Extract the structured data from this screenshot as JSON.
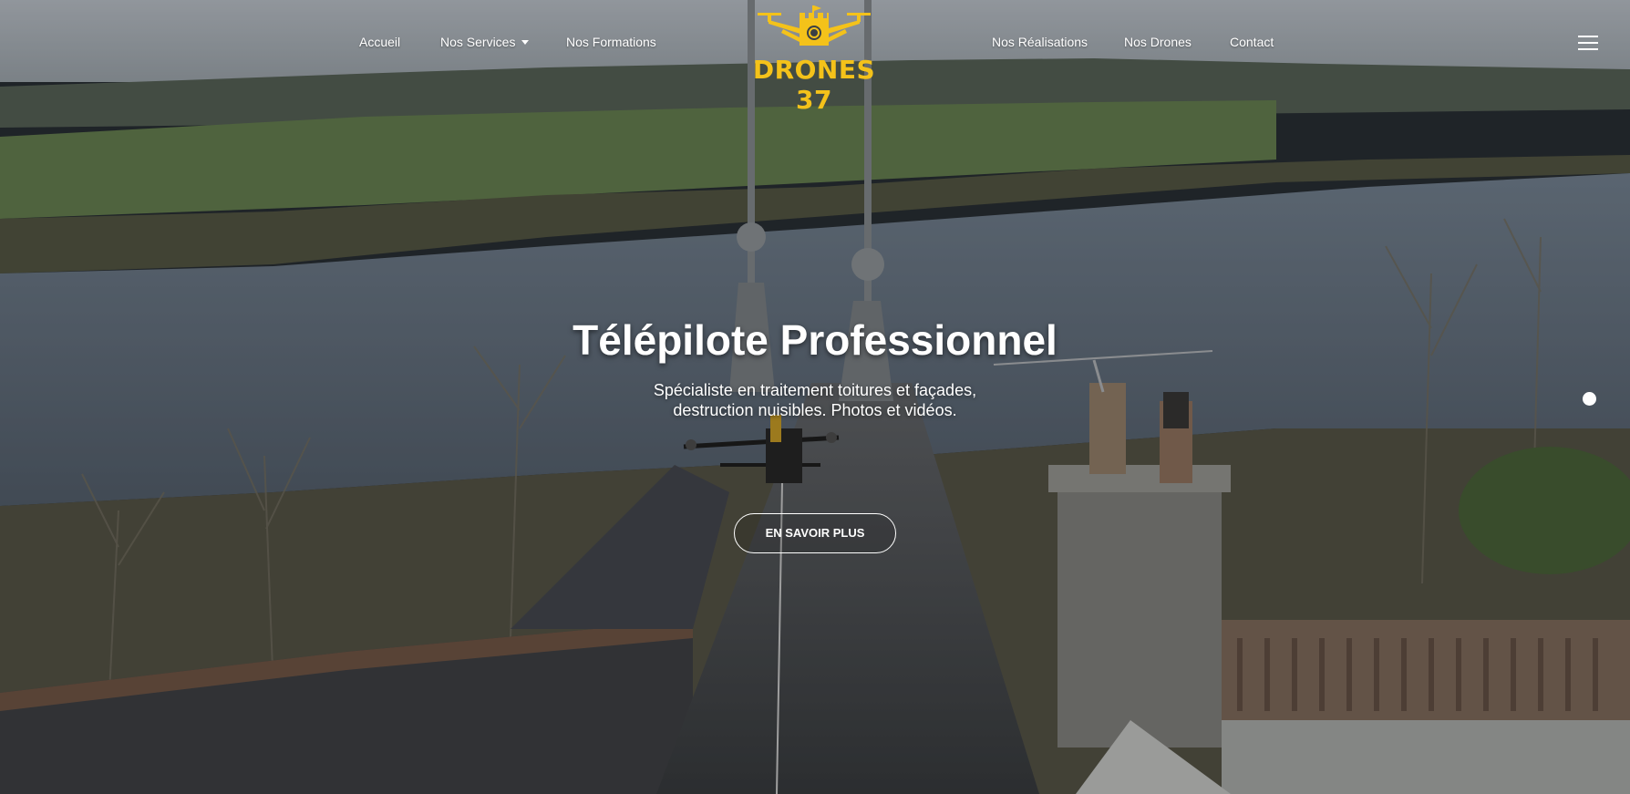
{
  "nav": {
    "left_items": [
      {
        "label": "Accueil"
      },
      {
        "label": "Nos Services"
      },
      {
        "label": "Nos Formations"
      }
    ],
    "right_items": [
      {
        "label": "Nos Réalisations"
      },
      {
        "label": "Nos Drones"
      },
      {
        "label": "Contact"
      }
    ],
    "menu_icon": "hamburger-menu-icon"
  },
  "logo": {
    "text": "DRONES 37",
    "color": "#f4c21a",
    "icon": "drone-castle-logo"
  },
  "hero": {
    "title": "Télépilote Professionnel",
    "subtitle_line1": "Spécialiste en traitement toitures et façades,",
    "subtitle_line2": "destruction nuisibles. Photos et vidéos.",
    "cta_label": "EN SAVOIR PLUS",
    "background": "aerial-photo-drone-over-chateau-roof-and-loire-river"
  },
  "slider": {
    "dots": 1,
    "active": 1
  }
}
